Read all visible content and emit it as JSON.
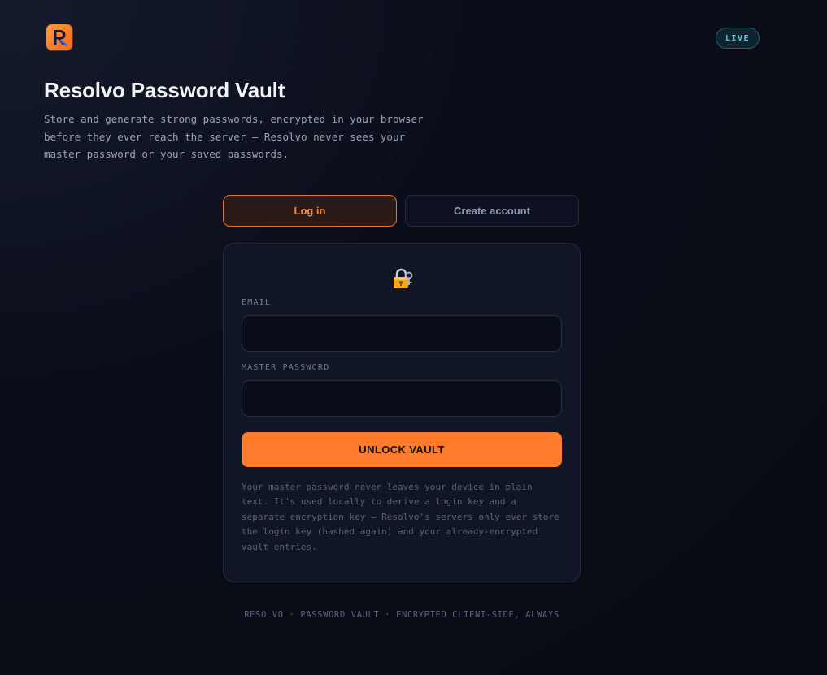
{
  "header": {
    "logo_icon": "resolvo-logo-icon",
    "badge": "LIVE"
  },
  "hero": {
    "title": "Resolvo Password Vault",
    "subtitle": "Store and generate strong passwords, encrypted in your browser before they ever reach the server — Resolvo never sees your master password or your saved passwords."
  },
  "tabs": [
    {
      "label": "Log in",
      "active": true
    },
    {
      "label": "Create account",
      "active": false
    }
  ],
  "login_form": {
    "icon": "lock-icon",
    "email_label": "EMAIL",
    "email_value": "",
    "password_label": "MASTER PASSWORD",
    "password_value": "",
    "submit_label": "UNLOCK VAULT",
    "help_text": "Your master password never leaves your device in plain text. It's used locally to derive a login key and a separate encryption key — Resolvo's servers only ever store the login key (hashed again) and your already-encrypted vault entries."
  },
  "footer": {
    "text": "RESOLVO · PASSWORD VAULT · ENCRYPTED CLIENT-SIDE, ALWAYS"
  },
  "colors": {
    "accent": "#ff7b2e",
    "live": "#5cc8e0",
    "background": "#0a0d18"
  }
}
